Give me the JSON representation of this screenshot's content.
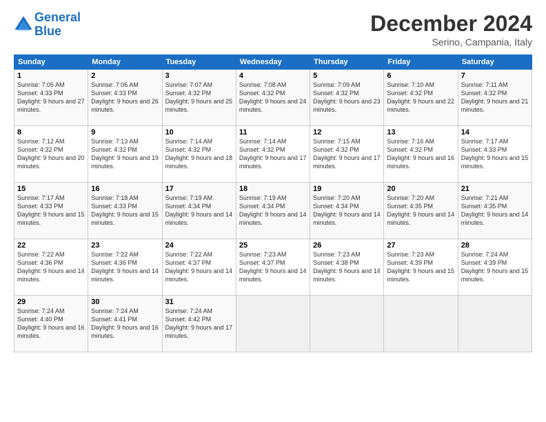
{
  "header": {
    "logo_line1": "General",
    "logo_line2": "Blue",
    "month_title": "December 2024",
    "subtitle": "Serino, Campania, Italy"
  },
  "weekdays": [
    "Sunday",
    "Monday",
    "Tuesday",
    "Wednesday",
    "Thursday",
    "Friday",
    "Saturday"
  ],
  "weeks": [
    [
      {
        "day": "1",
        "sunrise": "Sunrise: 7:05 AM",
        "sunset": "Sunset: 4:33 PM",
        "daylight": "Daylight: 9 hours and 27 minutes."
      },
      {
        "day": "2",
        "sunrise": "Sunrise: 7:06 AM",
        "sunset": "Sunset: 4:33 PM",
        "daylight": "Daylight: 9 hours and 26 minutes."
      },
      {
        "day": "3",
        "sunrise": "Sunrise: 7:07 AM",
        "sunset": "Sunset: 4:32 PM",
        "daylight": "Daylight: 9 hours and 25 minutes."
      },
      {
        "day": "4",
        "sunrise": "Sunrise: 7:08 AM",
        "sunset": "Sunset: 4:32 PM",
        "daylight": "Daylight: 9 hours and 24 minutes."
      },
      {
        "day": "5",
        "sunrise": "Sunrise: 7:09 AM",
        "sunset": "Sunset: 4:32 PM",
        "daylight": "Daylight: 9 hours and 23 minutes."
      },
      {
        "day": "6",
        "sunrise": "Sunrise: 7:10 AM",
        "sunset": "Sunset: 4:32 PM",
        "daylight": "Daylight: 9 hours and 22 minutes."
      },
      {
        "day": "7",
        "sunrise": "Sunrise: 7:11 AM",
        "sunset": "Sunset: 4:32 PM",
        "daylight": "Daylight: 9 hours and 21 minutes."
      }
    ],
    [
      {
        "day": "8",
        "sunrise": "Sunrise: 7:12 AM",
        "sunset": "Sunset: 4:32 PM",
        "daylight": "Daylight: 9 hours and 20 minutes."
      },
      {
        "day": "9",
        "sunrise": "Sunrise: 7:13 AM",
        "sunset": "Sunset: 4:32 PM",
        "daylight": "Daylight: 9 hours and 19 minutes."
      },
      {
        "day": "10",
        "sunrise": "Sunrise: 7:14 AM",
        "sunset": "Sunset: 4:32 PM",
        "daylight": "Daylight: 9 hours and 18 minutes."
      },
      {
        "day": "11",
        "sunrise": "Sunrise: 7:14 AM",
        "sunset": "Sunset: 4:32 PM",
        "daylight": "Daylight: 9 hours and 17 minutes."
      },
      {
        "day": "12",
        "sunrise": "Sunrise: 7:15 AM",
        "sunset": "Sunset: 4:32 PM",
        "daylight": "Daylight: 9 hours and 17 minutes."
      },
      {
        "day": "13",
        "sunrise": "Sunrise: 7:16 AM",
        "sunset": "Sunset: 4:32 PM",
        "daylight": "Daylight: 9 hours and 16 minutes."
      },
      {
        "day": "14",
        "sunrise": "Sunrise: 7:17 AM",
        "sunset": "Sunset: 4:33 PM",
        "daylight": "Daylight: 9 hours and 15 minutes."
      }
    ],
    [
      {
        "day": "15",
        "sunrise": "Sunrise: 7:17 AM",
        "sunset": "Sunset: 4:33 PM",
        "daylight": "Daylight: 9 hours and 15 minutes."
      },
      {
        "day": "16",
        "sunrise": "Sunrise: 7:18 AM",
        "sunset": "Sunset: 4:33 PM",
        "daylight": "Daylight: 9 hours and 15 minutes."
      },
      {
        "day": "17",
        "sunrise": "Sunrise: 7:19 AM",
        "sunset": "Sunset: 4:34 PM",
        "daylight": "Daylight: 9 hours and 14 minutes."
      },
      {
        "day": "18",
        "sunrise": "Sunrise: 7:19 AM",
        "sunset": "Sunset: 4:34 PM",
        "daylight": "Daylight: 9 hours and 14 minutes."
      },
      {
        "day": "19",
        "sunrise": "Sunrise: 7:20 AM",
        "sunset": "Sunset: 4:34 PM",
        "daylight": "Daylight: 9 hours and 14 minutes."
      },
      {
        "day": "20",
        "sunrise": "Sunrise: 7:20 AM",
        "sunset": "Sunset: 4:35 PM",
        "daylight": "Daylight: 9 hours and 14 minutes."
      },
      {
        "day": "21",
        "sunrise": "Sunrise: 7:21 AM",
        "sunset": "Sunset: 4:35 PM",
        "daylight": "Daylight: 9 hours and 14 minutes."
      }
    ],
    [
      {
        "day": "22",
        "sunrise": "Sunrise: 7:22 AM",
        "sunset": "Sunset: 4:36 PM",
        "daylight": "Daylight: 9 hours and 14 minutes."
      },
      {
        "day": "23",
        "sunrise": "Sunrise: 7:22 AM",
        "sunset": "Sunset: 4:36 PM",
        "daylight": "Daylight: 9 hours and 14 minutes."
      },
      {
        "day": "24",
        "sunrise": "Sunrise: 7:22 AM",
        "sunset": "Sunset: 4:37 PM",
        "daylight": "Daylight: 9 hours and 14 minutes."
      },
      {
        "day": "25",
        "sunrise": "Sunrise: 7:23 AM",
        "sunset": "Sunset: 4:37 PM",
        "daylight": "Daylight: 9 hours and 14 minutes."
      },
      {
        "day": "26",
        "sunrise": "Sunrise: 7:23 AM",
        "sunset": "Sunset: 4:38 PM",
        "daylight": "Daylight: 9 hours and 14 minutes."
      },
      {
        "day": "27",
        "sunrise": "Sunrise: 7:23 AM",
        "sunset": "Sunset: 4:39 PM",
        "daylight": "Daylight: 9 hours and 15 minutes."
      },
      {
        "day": "28",
        "sunrise": "Sunrise: 7:24 AM",
        "sunset": "Sunset: 4:39 PM",
        "daylight": "Daylight: 9 hours and 15 minutes."
      }
    ],
    [
      {
        "day": "29",
        "sunrise": "Sunrise: 7:24 AM",
        "sunset": "Sunset: 4:40 PM",
        "daylight": "Daylight: 9 hours and 16 minutes."
      },
      {
        "day": "30",
        "sunrise": "Sunrise: 7:24 AM",
        "sunset": "Sunset: 4:41 PM",
        "daylight": "Daylight: 9 hours and 16 minutes."
      },
      {
        "day": "31",
        "sunrise": "Sunrise: 7:24 AM",
        "sunset": "Sunset: 4:42 PM",
        "daylight": "Daylight: 9 hours and 17 minutes."
      },
      null,
      null,
      null,
      null
    ]
  ]
}
